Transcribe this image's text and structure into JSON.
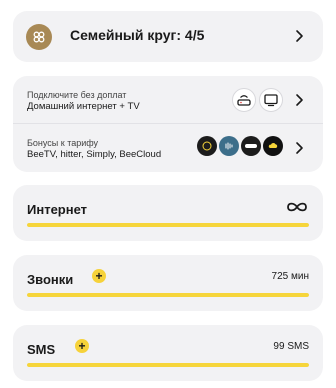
{
  "family": {
    "title": "Семейный круг: 4/5"
  },
  "offers": [
    {
      "subtitle": "Подключите без доплат",
      "title": "Домашний интернет + TV",
      "icons": [
        "router-icon",
        "tv-icon"
      ]
    },
    {
      "subtitle": "Бонусы к тарифу",
      "title": "BeeTV, hitter, Simply, BeeCloud",
      "brands": [
        "BeeTV",
        "hitter",
        "Simply",
        "BeeCloud"
      ]
    }
  ],
  "usage": {
    "internet": {
      "label": "Интернет",
      "value": "∞",
      "fill": 1.0
    },
    "calls": {
      "label": "Звонки",
      "value": "725 мин",
      "fill": 1.0
    },
    "sms": {
      "label": "SMS",
      "value": "99 SMS",
      "fill": 1.0
    }
  },
  "colors": {
    "accent": "#f6d53a",
    "card": "#f2f2f4",
    "avatar": "#a88955"
  }
}
